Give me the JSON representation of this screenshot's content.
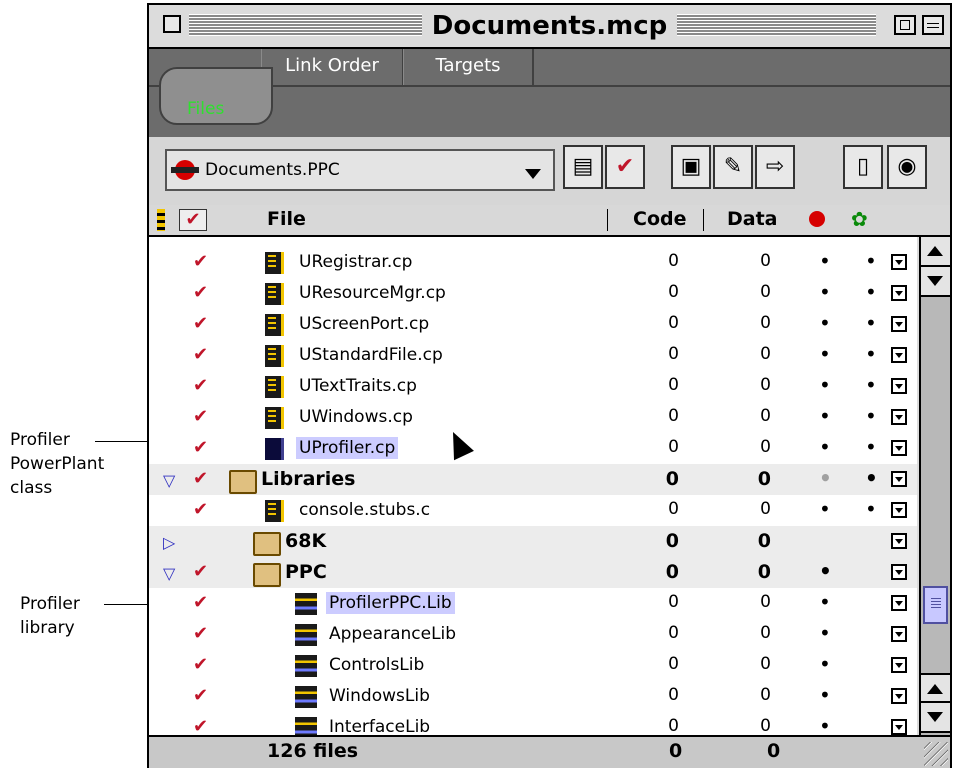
{
  "callouts": {
    "profiler_class": [
      "Profiler",
      "PowerPlant",
      "class"
    ],
    "profiler_library": [
      "Profiler",
      "library"
    ]
  },
  "window": {
    "title": "Documents.mcp"
  },
  "tabs": [
    {
      "label": "Files",
      "active": true
    },
    {
      "label": "Link Order",
      "active": false
    },
    {
      "label": "Targets",
      "active": false
    }
  ],
  "toolbar": {
    "target": "Documents.PPC",
    "buttons": [
      "make-icon",
      "check-syntax-icon",
      "compile-icon",
      "bring-up-to-date-icon",
      "run-icon",
      "project-inspector-icon",
      "debug-icon"
    ]
  },
  "columns": {
    "file": "File",
    "code": "Code",
    "data": "Data"
  },
  "rows": [
    {
      "type": "file",
      "icon": "cp",
      "name": "URegistrar.cp",
      "code": "0",
      "data": "0",
      "dot1": "•",
      "dot2": "•"
    },
    {
      "type": "file",
      "icon": "cp",
      "name": "UResourceMgr.cp",
      "code": "0",
      "data": "0",
      "dot1": "•",
      "dot2": "•"
    },
    {
      "type": "file",
      "icon": "cp",
      "name": "UScreenPort.cp",
      "code": "0",
      "data": "0",
      "dot1": "•",
      "dot2": "•"
    },
    {
      "type": "file",
      "icon": "cp",
      "name": "UStandardFile.cp",
      "code": "0",
      "data": "0",
      "dot1": "•",
      "dot2": "•"
    },
    {
      "type": "file",
      "icon": "cp",
      "name": "UTextTraits.cp",
      "code": "0",
      "data": "0",
      "dot1": "•",
      "dot2": "•"
    },
    {
      "type": "file",
      "icon": "cp",
      "name": "UWindows.cp",
      "code": "0",
      "data": "0",
      "dot1": "•",
      "dot2": "•"
    },
    {
      "type": "file",
      "icon": "dark",
      "name": "UProfiler.cp",
      "code": "0",
      "data": "0",
      "dot1": "•",
      "dot2": "•",
      "selected": true
    },
    {
      "type": "group",
      "expanded": true,
      "name": "Libraries",
      "code": "0",
      "data": "0",
      "dot1": "•",
      "dot2": "•",
      "dot1_gray": true
    },
    {
      "type": "file",
      "icon": "cp",
      "name": "console.stubs.c",
      "code": "0",
      "data": "0",
      "dot1": "•",
      "dot2": "•"
    },
    {
      "type": "group",
      "expanded": false,
      "name": "68K",
      "code": "0",
      "data": "0",
      "dot1": "",
      "dot2": ""
    },
    {
      "type": "group",
      "expanded": true,
      "name": "PPC",
      "code": "0",
      "data": "0",
      "dot1": "•",
      "dot2": ""
    },
    {
      "type": "file",
      "icon": "lib",
      "name": "ProfilerPPC.Lib",
      "code": "0",
      "data": "0",
      "dot1": "•",
      "dot2": "",
      "selected": true,
      "indent": true
    },
    {
      "type": "file",
      "icon": "lib",
      "name": "AppearanceLib",
      "code": "0",
      "data": "0",
      "dot1": "•",
      "dot2": "",
      "indent": true
    },
    {
      "type": "file",
      "icon": "lib",
      "name": "ControlsLib",
      "code": "0",
      "data": "0",
      "dot1": "•",
      "dot2": "",
      "indent": true
    },
    {
      "type": "file",
      "icon": "lib",
      "name": "WindowsLib",
      "code": "0",
      "data": "0",
      "dot1": "•",
      "dot2": "",
      "indent": true
    },
    {
      "type": "file",
      "icon": "lib",
      "name": "InterfaceLib",
      "code": "0",
      "data": "0",
      "dot1": "•",
      "dot2": "",
      "indent": true
    }
  ],
  "footer": {
    "count": "126 files",
    "code": "0",
    "data": "0"
  },
  "colors": {
    "check": "#c0152a",
    "selection": "#ccccff",
    "files_tab_text": "#2fe02f"
  }
}
